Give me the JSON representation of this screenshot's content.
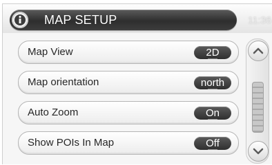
{
  "header": {
    "title": "MAP SETUP",
    "time": "11:36",
    "icon": "info-icon"
  },
  "settings": [
    {
      "label": "Map View",
      "value": "2D"
    },
    {
      "label": "Map orientation",
      "value": "north"
    },
    {
      "label": "Auto Zoom",
      "value": "On"
    },
    {
      "label": "Show POIs In Map",
      "value": "Off"
    }
  ],
  "scrollbar": {
    "up_icon": "chevron-up-icon",
    "down_icon": "chevron-down-icon"
  },
  "colors": {
    "header_bar": "#3a3a3a",
    "value_button": "#3f3f3f",
    "row_background": "#f4f4f4"
  }
}
